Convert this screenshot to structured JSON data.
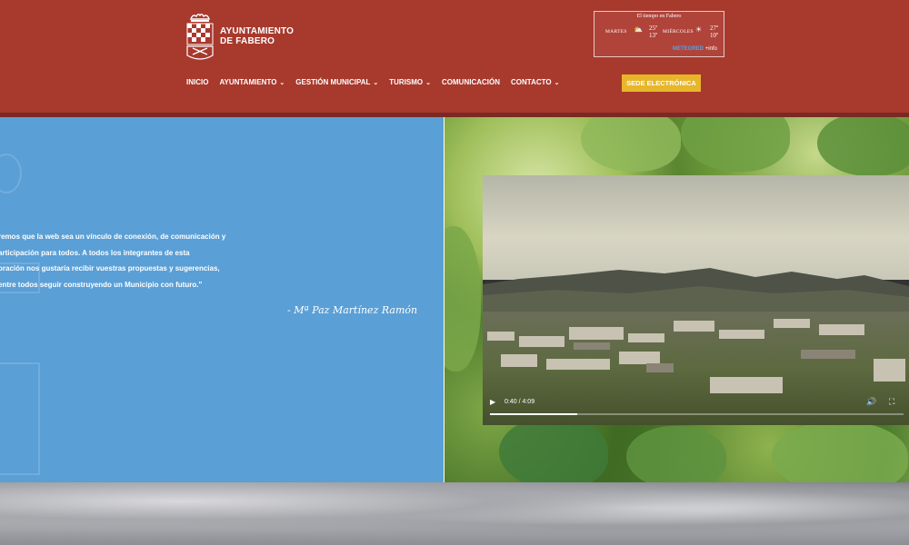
{
  "header": {
    "logo_line1": "AYUNTAMIENTO",
    "logo_line2": "DE FABERO",
    "sede_button": "SEDE ELECTRÓNICA",
    "nav": [
      {
        "label": "INICIO",
        "dropdown": false
      },
      {
        "label": "AYUNTAMIENTO",
        "dropdown": true
      },
      {
        "label": "GESTIÓN MUNICIPAL",
        "dropdown": true
      },
      {
        "label": "TURISMO",
        "dropdown": true
      },
      {
        "label": "COMUNICACIÓN",
        "dropdown": false
      },
      {
        "label": "CONTACTO",
        "dropdown": true
      }
    ]
  },
  "weather": {
    "title": "El tiempo en Fabero",
    "day1": "MARTES",
    "day1_high": "25º",
    "day1_low": "13º",
    "day2": "MIÉRCOLES",
    "day2_high": "27º",
    "day2_low": "10º",
    "brand": "METEORED",
    "brand_suffix": "+info",
    "icon1": "cloudy-sun-icon",
    "icon2": "sun-icon"
  },
  "quote": {
    "lines": [
      "remos que la web sea un vínculo de conexión, de comunicación y",
      "articipación para todos. A todos los integrantes de esta",
      "oración nos gustaría recibir vuestras propuestas y sugerencias,",
      "entre todos seguir construyendo un Municipio con futuro.\""
    ],
    "signature": "- Mª Paz Martínez Ramón"
  },
  "video": {
    "time": "0:40 / 4:09",
    "progress": 0.21
  },
  "colors": {
    "header_bg": "#a8392d",
    "blue_panel": "#5a9fd6",
    "sede_bg": "#e7b62a"
  }
}
